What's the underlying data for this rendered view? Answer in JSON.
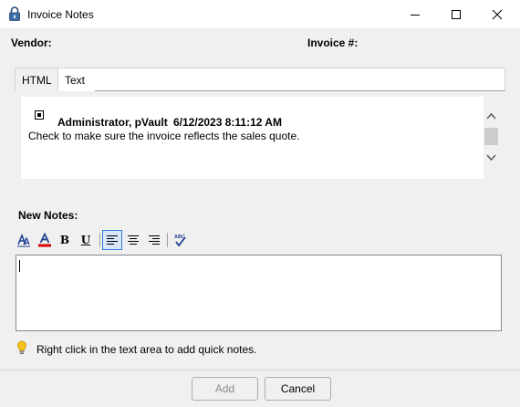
{
  "window": {
    "title": "Invoice Notes",
    "icon": "lock-icon",
    "controls": [
      "minimize",
      "maximize",
      "close"
    ]
  },
  "header": {
    "vendor_label": "Vendor:",
    "invoice_label": "Invoice #:"
  },
  "tabs": [
    {
      "label": "HTML",
      "selected": true
    },
    {
      "label": "Text",
      "selected": false
    }
  ],
  "notes": [
    {
      "author": "Administrator, pVault",
      "date": "6/12/2023 8:11:12 AM",
      "text": "Check to make sure the invoice reflects the sales quote."
    }
  ],
  "new_notes": {
    "label": "New Notes:",
    "value": "",
    "toolbar": [
      {
        "name": "font-icon"
      },
      {
        "name": "font-color-icon",
        "color": "#d40000"
      },
      {
        "name": "bold",
        "label": "B"
      },
      {
        "name": "underline",
        "label": "U"
      },
      {
        "name": "align-left-icon",
        "active": true
      },
      {
        "name": "align-center-icon"
      },
      {
        "name": "align-right-icon"
      },
      {
        "name": "spell-check-icon",
        "label": "ABC"
      }
    ]
  },
  "hint": {
    "icon": "lightbulb-icon",
    "text": "Right click in the text area to add quick notes."
  },
  "buttons": {
    "add_label": "Add",
    "add_enabled": false,
    "cancel_label": "Cancel"
  }
}
